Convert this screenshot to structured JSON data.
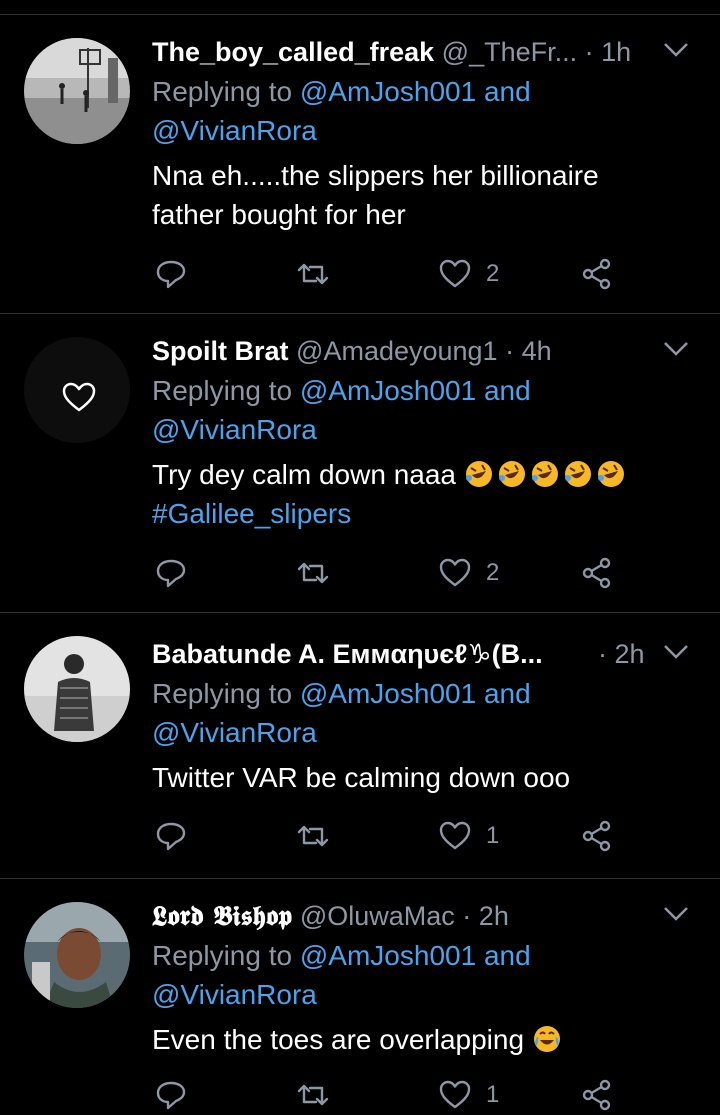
{
  "colors": {
    "background": "#000000",
    "secondary_text": "#8b98a5",
    "link": "#4aa3ee",
    "divider": "#2f3336"
  },
  "tweets": [
    {
      "name": "The_boy_called_freak",
      "handle": "@_TheFr...",
      "dot": "·",
      "time": "1h",
      "replying_prefix": "Replying to",
      "mention1": "@AmJosh001",
      "and": "and",
      "mention2": "@VivianRora",
      "text1": "Nna eh.....the slippers her billionaire",
      "text2": "father bought for her",
      "like_count": "2",
      "avatar_icon": "photo-avatar-basketball-court"
    },
    {
      "name": "Spoilt Brat",
      "handle": "@Amadeyoung1",
      "dot": "·",
      "time": "4h",
      "replying_prefix": "Replying to",
      "mention1": "@AmJosh001",
      "and": "and",
      "mention2": "@VivianRora",
      "text1": "Try dey calm down naaa",
      "emoji": "rolling-on-floor-laughing-emoji",
      "hashtag": "#Galilee_slipers",
      "like_count": "2",
      "avatar_icon": "heart-icon"
    },
    {
      "name": "Babatunde A. Eммαηυєℓ♑(B...",
      "handle": "",
      "dot": "·",
      "time": "2h",
      "replying_prefix": "Replying to",
      "mention1": "@AmJosh001",
      "and": "and",
      "mention2": "@VivianRora",
      "text1": "Twitter VAR be calming down ooo",
      "like_count": "1",
      "avatar_icon": "photo-avatar-man-standing"
    },
    {
      "name": "𝕷𝖔𝖗𝖉 𝕭𝖎𝖘𝖍𝖔𝖕",
      "handle": "@OluwaMac",
      "dot": "·",
      "time": "2h",
      "replying_prefix": "Replying to",
      "mention1": "@AmJosh001",
      "and": "and",
      "mention2": "@VivianRora",
      "text1": "Even the toes are overlapping",
      "emoji": "face-with-tears-of-joy-emoji",
      "like_count": "1",
      "avatar_icon": "photo-avatar-selfie"
    }
  ]
}
